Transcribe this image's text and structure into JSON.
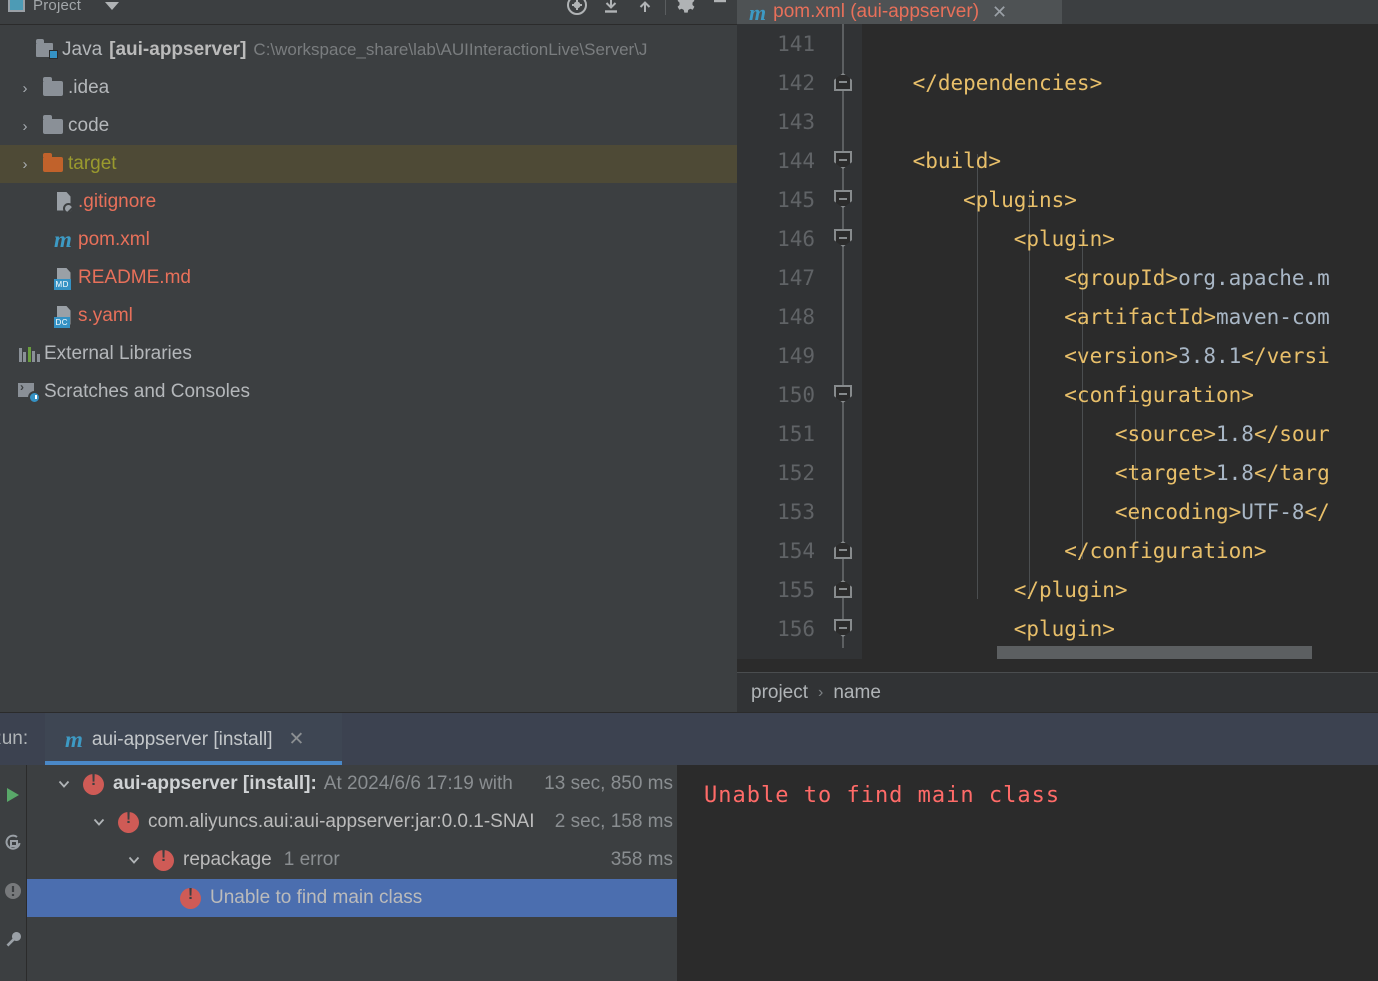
{
  "project_panel": {
    "title": "Project",
    "icons": {
      "project_icon": "project-window-icon",
      "chevron": "chevron-down-icon",
      "locate_file": "locate-opened-file-icon",
      "expand_all": "expand-all-icon",
      "collapse_all": "collapse-all-icon",
      "settings": "gear-icon",
      "hide": "minimize-icon"
    },
    "tree": [
      {
        "id": "module-root",
        "arrow": "",
        "icon": "java-module-icon",
        "prefix": "Java",
        "name": "[aui-appserver]",
        "path": "C:\\workspace_share\\lab\\AUIInteractionLive\\Server\\J",
        "indent": 0,
        "state": "normal"
      },
      {
        "id": "idea",
        "arrow": "›",
        "icon": "folder-icon",
        "name": ".idea",
        "indent": 1,
        "state": "normal"
      },
      {
        "id": "code",
        "arrow": "›",
        "icon": "folder-icon",
        "name": "code",
        "indent": 1,
        "state": "normal"
      },
      {
        "id": "target",
        "arrow": "›",
        "icon": "folder-orange-icon",
        "name": "target",
        "indent": 1,
        "state": "highlighted"
      },
      {
        "id": "gitignore",
        "arrow": "",
        "icon": "gitignore-file-icon",
        "name": ".gitignore",
        "indent": 2,
        "state": "normal"
      },
      {
        "id": "pom",
        "arrow": "",
        "icon": "maven-m-icon",
        "name": "pom.xml",
        "indent": 2,
        "state": "normal"
      },
      {
        "id": "readme",
        "arrow": "",
        "icon": "markdown-file-icon",
        "name": "README.md",
        "indent": 2,
        "state": "normal"
      },
      {
        "id": "syaml",
        "arrow": "",
        "icon": "docker-compose-file-icon",
        "name": "s.yaml",
        "indent": 2,
        "state": "normal"
      },
      {
        "id": "external-libraries",
        "arrow": "",
        "icon": "libraries-icon",
        "name": "External Libraries",
        "indent": 0,
        "state": "normal"
      },
      {
        "id": "scratches",
        "arrow": "",
        "icon": "scratches-icon",
        "name": "Scratches and Consoles",
        "indent": 0,
        "state": "normal"
      }
    ],
    "badges": {
      "markdown": "MD",
      "docker": "DC"
    }
  },
  "editor": {
    "tab": {
      "label": "pom.xml (aui-appserver)",
      "icon": "maven-m-icon",
      "close": "✕"
    },
    "first_line_number": 141,
    "lines": [
      {
        "num": "141",
        "fold": "line",
        "text": ""
      },
      {
        "num": "142",
        "fold": "up",
        "text": "    </dependencies>",
        "tokens": [
          {
            "t": "    </dependencies>",
            "c": "tag"
          }
        ]
      },
      {
        "num": "143",
        "fold": "line",
        "text": ""
      },
      {
        "num": "144",
        "fold": "down",
        "text": "    <build>",
        "tokens": [
          {
            "t": "    <build>",
            "c": "tag"
          }
        ]
      },
      {
        "num": "145",
        "fold": "down",
        "text": "        <plugins>",
        "tokens": [
          {
            "t": "        <plugins>",
            "c": "tag"
          }
        ]
      },
      {
        "num": "146",
        "fold": "down",
        "text": "            <plugin>",
        "tokens": [
          {
            "t": "            <plugin>",
            "c": "tag"
          }
        ]
      },
      {
        "num": "147",
        "fold": "none",
        "text": "                <groupId>org.apache.m",
        "tokens": [
          {
            "t": "                <groupId>",
            "c": "tag"
          },
          {
            "t": "org.apache.m",
            "c": "val"
          }
        ]
      },
      {
        "num": "148",
        "fold": "none",
        "text": "                <artifactId>maven-com",
        "tokens": [
          {
            "t": "                <artifactId>",
            "c": "tag"
          },
          {
            "t": "maven-com",
            "c": "val"
          }
        ]
      },
      {
        "num": "149",
        "fold": "none",
        "text": "                <version>3.8.1</versi",
        "tokens": [
          {
            "t": "                <version>",
            "c": "tag"
          },
          {
            "t": "3.8.1",
            "c": "val"
          },
          {
            "t": "</versi",
            "c": "tag"
          }
        ]
      },
      {
        "num": "150",
        "fold": "down",
        "text": "                <configuration>",
        "tokens": [
          {
            "t": "                <configuration>",
            "c": "tag"
          }
        ]
      },
      {
        "num": "151",
        "fold": "none",
        "text": "                    <source>1.8</sour",
        "tokens": [
          {
            "t": "                    <source>",
            "c": "tag"
          },
          {
            "t": "1.8",
            "c": "val"
          },
          {
            "t": "</sour",
            "c": "tag"
          }
        ]
      },
      {
        "num": "152",
        "fold": "none",
        "text": "                    <target>1.8</targ",
        "tokens": [
          {
            "t": "                    <target>",
            "c": "tag"
          },
          {
            "t": "1.8",
            "c": "val"
          },
          {
            "t": "</targ",
            "c": "tag"
          }
        ]
      },
      {
        "num": "153",
        "fold": "none",
        "text": "                    <encoding>UTF-8</",
        "tokens": [
          {
            "t": "                    <encoding>",
            "c": "tag"
          },
          {
            "t": "UTF-8",
            "c": "val"
          },
          {
            "t": "</",
            "c": "tag"
          }
        ]
      },
      {
        "num": "154",
        "fold": "up",
        "text": "                </configuration>",
        "tokens": [
          {
            "t": "                </configuration>",
            "c": "tag"
          }
        ]
      },
      {
        "num": "155",
        "fold": "up",
        "text": "            </plugin>",
        "tokens": [
          {
            "t": "            </plugin>",
            "c": "tag"
          }
        ]
      },
      {
        "num": "156",
        "fold": "down",
        "text": "            <plugin>",
        "tokens": [
          {
            "t": "            <plugin>",
            "c": "tag"
          }
        ]
      }
    ],
    "breadcrumb": [
      "project",
      "name"
    ],
    "breadcrumb_separator": "›"
  },
  "run_panel": {
    "label": "Run:",
    "tab": {
      "label": "aui-appserver [install]",
      "icon": "maven-m-icon",
      "close": "✕"
    },
    "sidebar_icons": [
      "run-icon",
      "rerun-icon",
      "toggle-errors-icon",
      "settings-wrench-icon"
    ],
    "tree": [
      {
        "id": "root",
        "indent": 0,
        "arrow": "⌄",
        "icon": "error-icon",
        "bold": "aui-appserver [install]:",
        "dim": "At 2024/6/6 17:19 with",
        "time": "13 sec, 850 ms",
        "selected": false
      },
      {
        "id": "artifact",
        "indent": 1,
        "arrow": "⌄",
        "icon": "error-icon",
        "bold": "",
        "dim": "com.aliyuncs.aui:aui-appserver:jar:0.0.1-SNAI",
        "time": "2 sec, 158 ms",
        "selected": false
      },
      {
        "id": "repackage",
        "indent": 2,
        "arrow": "⌄",
        "icon": "error-icon",
        "bold": "",
        "dim": "repackage",
        "extra": "1 error",
        "time": "358 ms",
        "selected": false
      },
      {
        "id": "unable",
        "indent": 3,
        "arrow": "",
        "icon": "error-icon",
        "bold": "",
        "dim": "Unable to find main class",
        "time": "",
        "selected": true
      }
    ],
    "console": {
      "message": "Unable to find main class"
    }
  },
  "colors": {
    "background": "#3c3f41",
    "editor_bg": "#2b2b2b",
    "gutter_bg": "#313335",
    "tab_active": "#4e5254",
    "selection_blue": "#4b6eaf",
    "run_tab_bg": "#3c4250",
    "accent_blue": "#4a88c7",
    "error_red": "#cf5b56",
    "console_red": "#ff6b68",
    "xml_tag": "#e8bf6a",
    "xml_value": "#a9b7c6",
    "file_red": "#e8705a",
    "folder_highlight": "#4e4a36",
    "target_olive": "#9a9a2e"
  }
}
